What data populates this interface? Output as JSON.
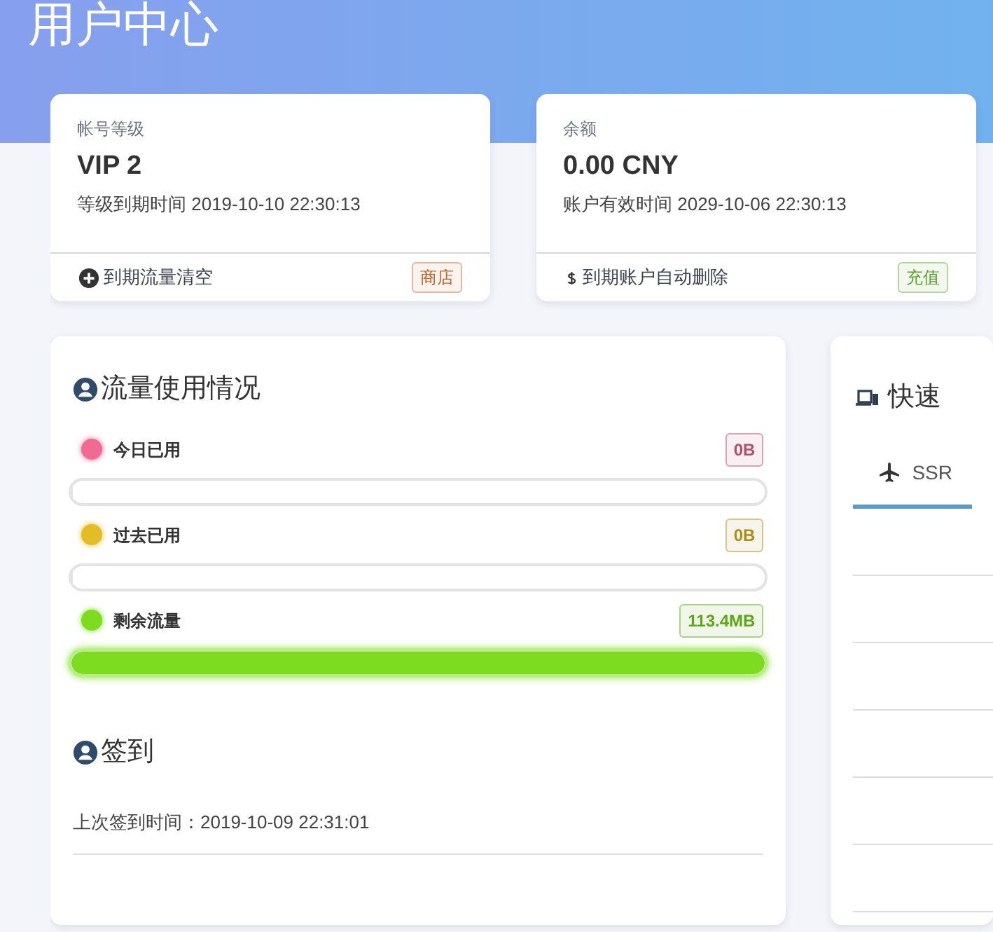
{
  "header": {
    "title": "用户中心"
  },
  "info_cards": [
    {
      "label": "帐号等级",
      "value": "VIP 2",
      "detail": "等级到期时间 2019-10-10 22:30:13",
      "footer": {
        "kind": "plus",
        "text": "到期流量清空"
      },
      "action": {
        "text": "商店",
        "color": "#c2622a"
      }
    },
    {
      "label": "余额",
      "value": "0.00 CNY",
      "detail": "账户有效时间 2029-10-06 22:30:13",
      "footer": {
        "kind": "dollar",
        "text": "到期账户自动删除"
      },
      "action": {
        "text": "充值",
        "color": "#56a22b"
      }
    }
  ],
  "traffic": {
    "title": "流量使用情况",
    "items": [
      {
        "label": "今日已用",
        "amount": "0B",
        "color": "#f06b94",
        "level": 0
      },
      {
        "label": "过去已用",
        "amount": "0B",
        "color": "#e2bd25",
        "level": 0
      },
      {
        "label": "剩余流量",
        "amount": "113.4MB",
        "color": "#7ddc1f",
        "level": 1
      }
    ]
  },
  "checkin": {
    "title": "签到",
    "last_time": "上次签到时间：2019-10-09 22:31:01"
  },
  "quick_panel": {
    "title": "快速",
    "tabs": [
      {
        "label": "SSR",
        "selected": true
      }
    ]
  }
}
